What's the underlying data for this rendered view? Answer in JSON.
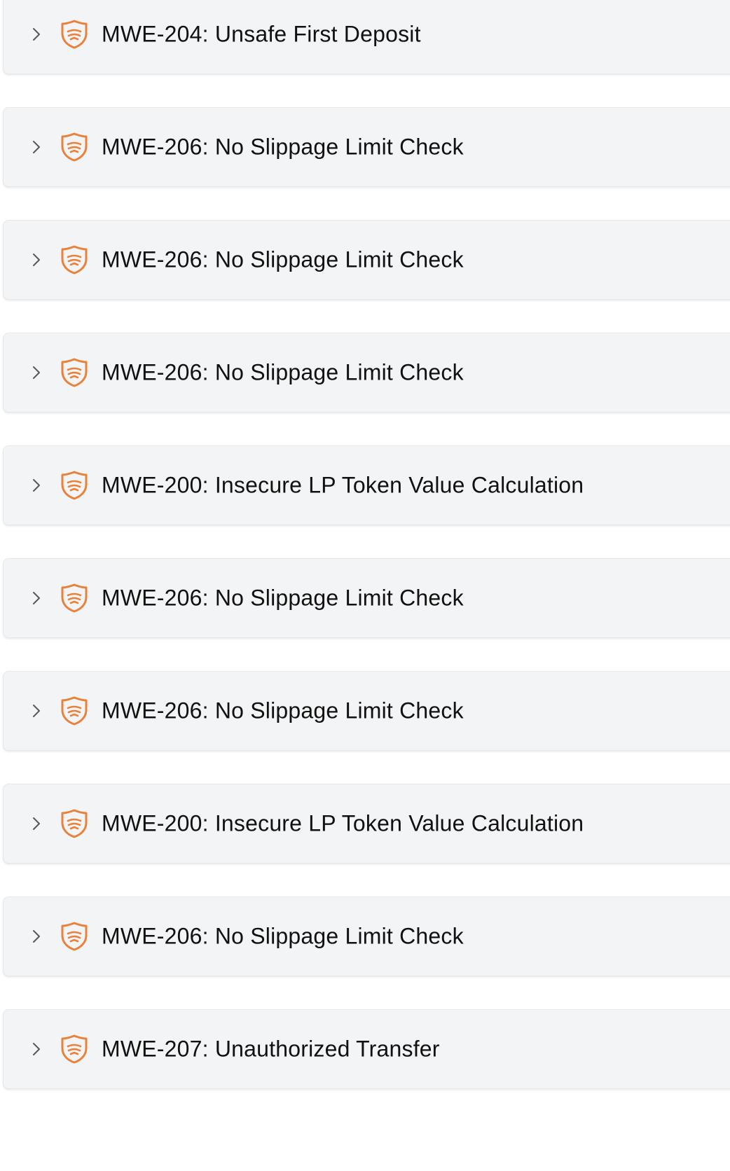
{
  "accent_color": "#e8823a",
  "icons": {
    "expand": "chevron-right-icon",
    "severity": "shield-icon"
  },
  "findings": [
    {
      "title": "MWE-204: Unsafe First Deposit"
    },
    {
      "title": "MWE-206: No Slippage Limit Check"
    },
    {
      "title": "MWE-206: No Slippage Limit Check"
    },
    {
      "title": "MWE-206: No Slippage Limit Check"
    },
    {
      "title": "MWE-200: Insecure LP Token Value Calculation"
    },
    {
      "title": "MWE-206: No Slippage Limit Check"
    },
    {
      "title": "MWE-206: No Slippage Limit Check"
    },
    {
      "title": "MWE-200: Insecure LP Token Value Calculation"
    },
    {
      "title": "MWE-206: No Slippage Limit Check"
    },
    {
      "title": "MWE-207: Unauthorized Transfer"
    }
  ]
}
